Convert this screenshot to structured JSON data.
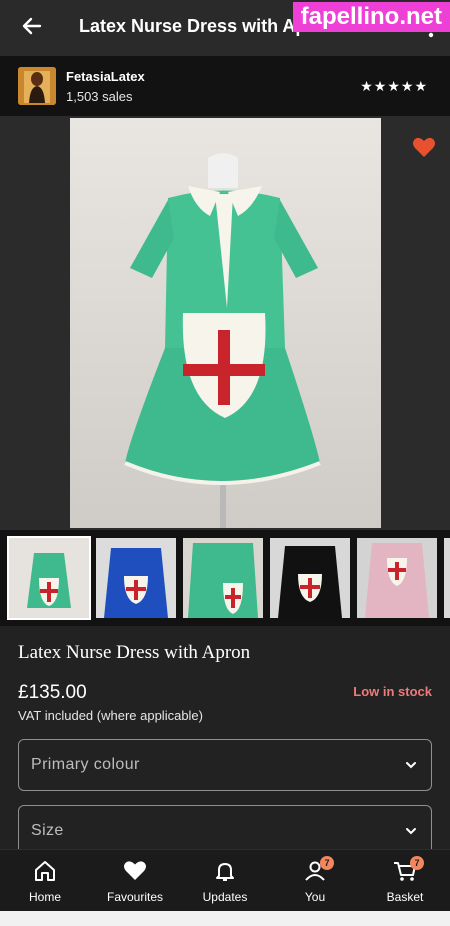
{
  "header": {
    "title": "Latex Nurse Dress with Apron",
    "watermark": "fapellino.net"
  },
  "shop": {
    "name": "FetasiaLatex",
    "sales": "1,503 sales",
    "rating_stars": "★★★★★"
  },
  "listing": {
    "title": "Latex Nurse Dress with Apron",
    "price": "£135.00",
    "stock_status": "Low in stock",
    "vat_note": "VAT included (where applicable)",
    "favourite_color": "#e8512f"
  },
  "thumbnails": [
    {
      "dress_color": "#3fb98e"
    },
    {
      "dress_color": "#1f4fbf"
    },
    {
      "dress_color": "#3fb98e"
    },
    {
      "dress_color": "#111111"
    },
    {
      "dress_color": "#e3b4c2"
    }
  ],
  "options": {
    "primary_colour_placeholder": "Primary colour",
    "size_placeholder": "Size"
  },
  "nav": {
    "home": "Home",
    "favourites": "Favourites",
    "updates": "Updates",
    "you": "You",
    "basket": "Basket",
    "you_badge": "7",
    "basket_badge": "7"
  },
  "colors": {
    "accent_badge": "#f2865e",
    "stock_red": "#f07a7a"
  }
}
